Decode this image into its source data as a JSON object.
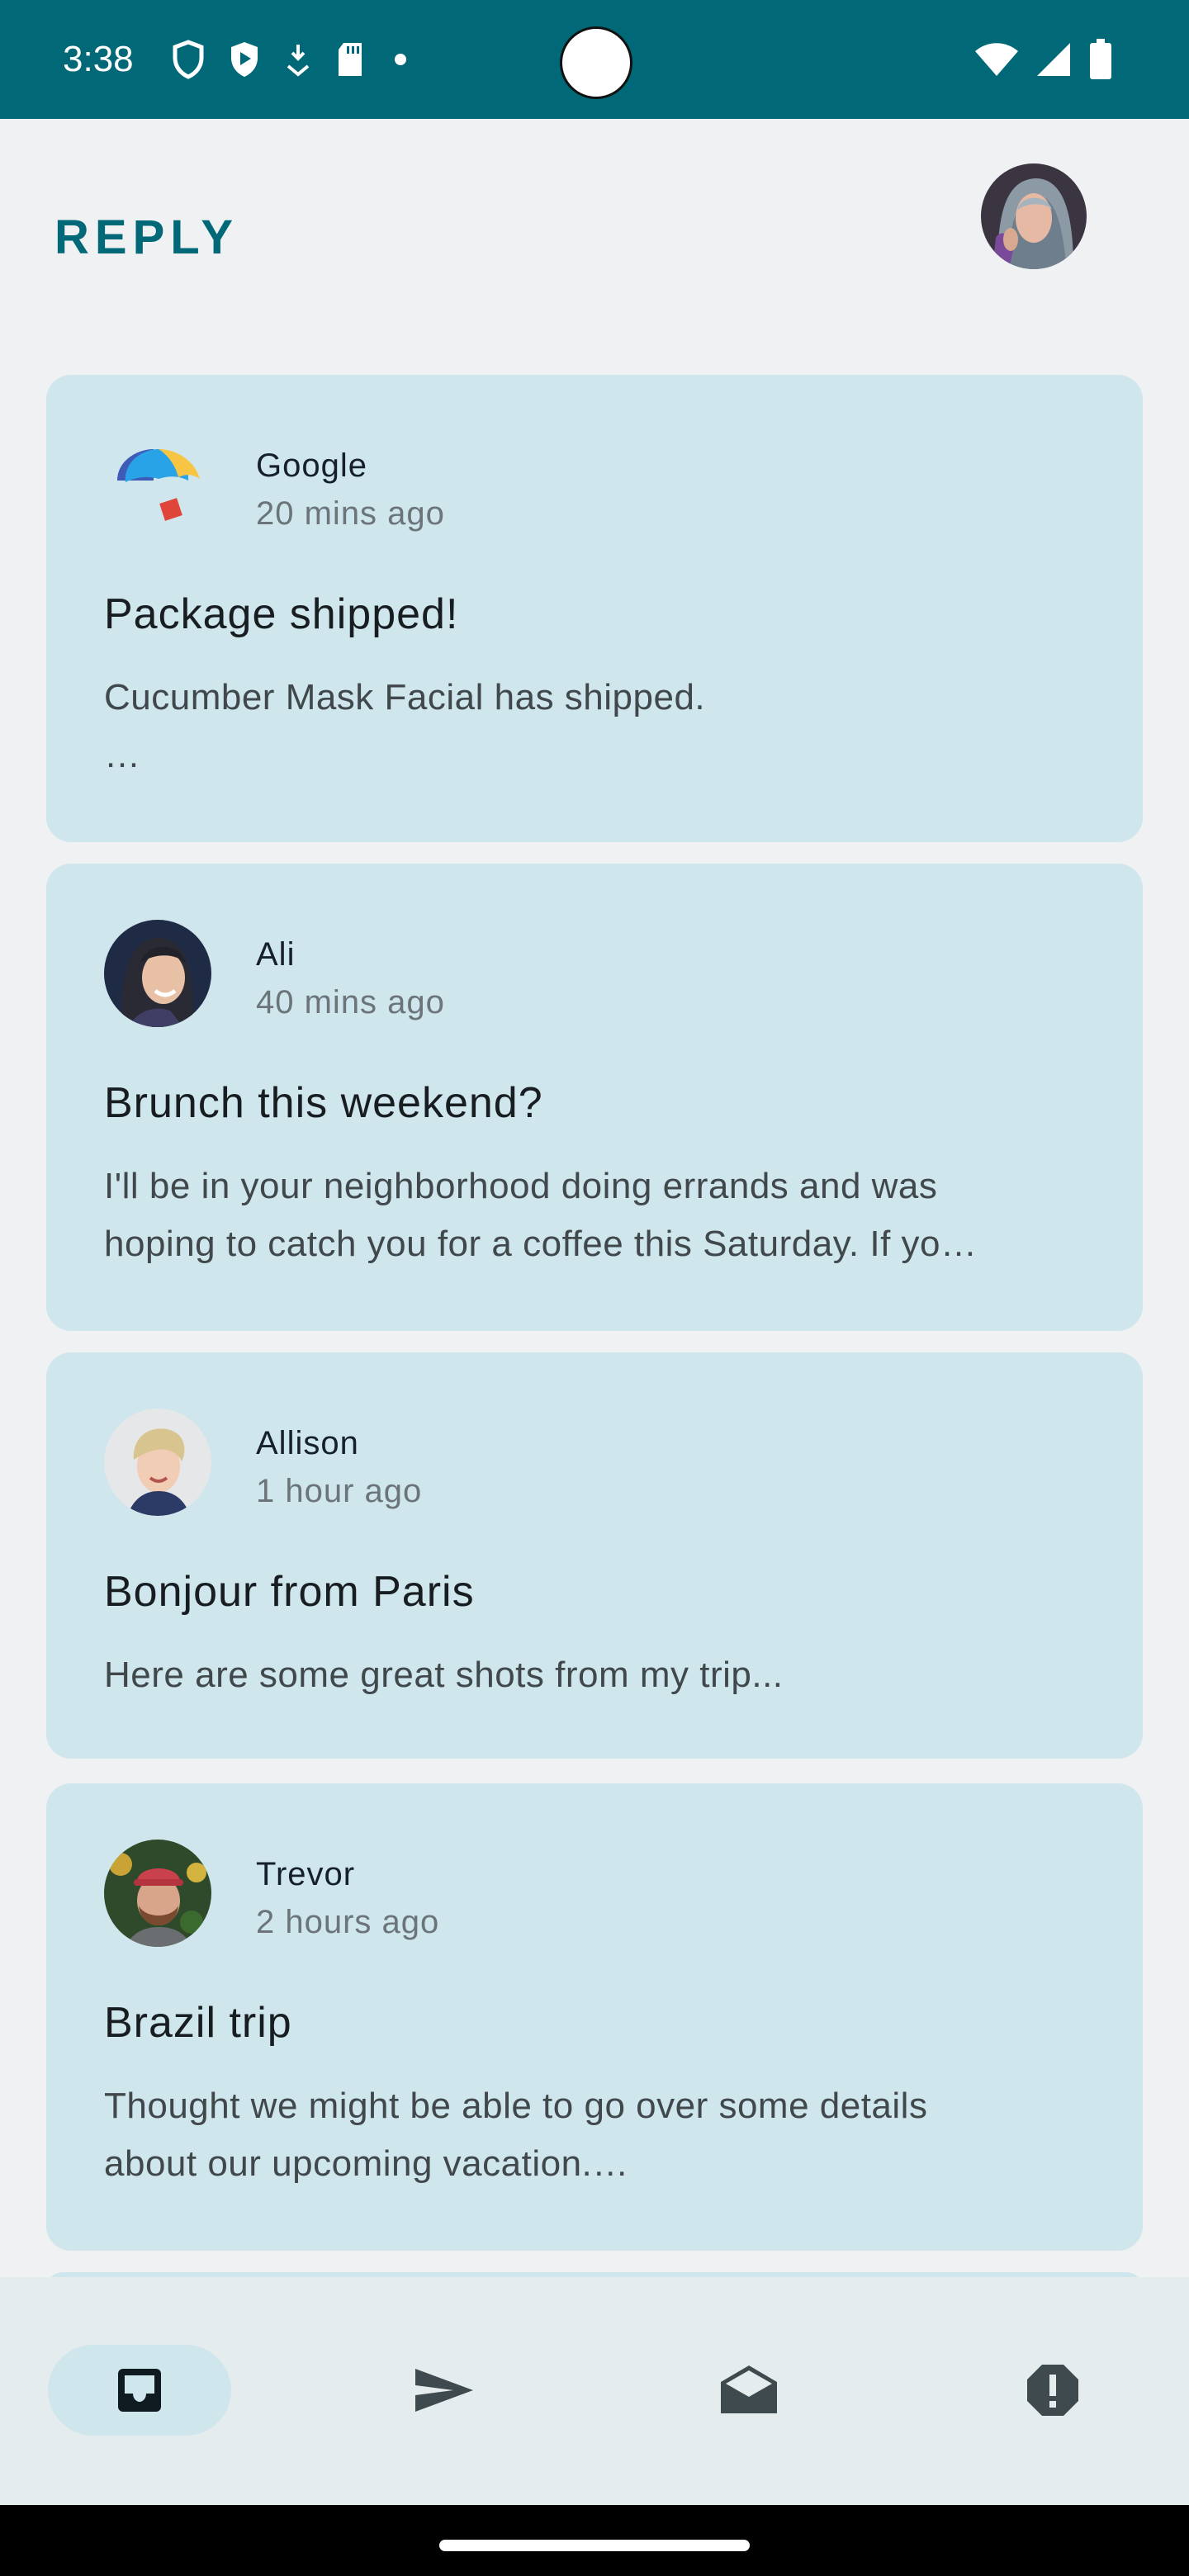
{
  "status_bar": {
    "time": "3:38",
    "icons": [
      "shield-icon",
      "play-protect-icon",
      "download-icon",
      "sd-card-icon",
      "dot-icon"
    ],
    "right_icons": [
      "wifi-icon",
      "signal-icon",
      "battery-icon"
    ]
  },
  "header": {
    "title": "REPLY",
    "profile_avatar": "profile-avatar"
  },
  "emails": [
    {
      "sender": "Google",
      "time": "20 mins ago",
      "subject": "Package shipped!",
      "body": "Cucumber Mask Facial has shipped.\n…",
      "avatar": "google-umbrella-logo"
    },
    {
      "sender": "Ali",
      "time": "40 mins ago",
      "subject": "Brunch this weekend?",
      "body": "I'll be in your neighborhood doing errands and was\nhoping to catch you for a coffee this Saturday. If yo…",
      "avatar": "ali-avatar"
    },
    {
      "sender": "Allison",
      "time": "1 hour ago",
      "subject": "Bonjour from Paris",
      "body": "Here are some great shots from my trip...",
      "avatar": "allison-avatar"
    },
    {
      "sender": "Trevor",
      "time": "2 hours ago",
      "subject": "Brazil trip",
      "body": "Thought we might be able to go over some details\nabout our upcoming vacation.…",
      "avatar": "trevor-avatar"
    }
  ],
  "bottom_nav": {
    "items": [
      {
        "icon": "inbox-icon",
        "active": true
      },
      {
        "icon": "send-icon",
        "active": false
      },
      {
        "icon": "drafts-icon",
        "active": false
      },
      {
        "icon": "report-icon",
        "active": false
      }
    ]
  },
  "colors": {
    "status_bar": "#006876",
    "accent": "#006876",
    "card": "#cfe6ed",
    "background": "#eff1f3",
    "nav": "#e5eced"
  }
}
